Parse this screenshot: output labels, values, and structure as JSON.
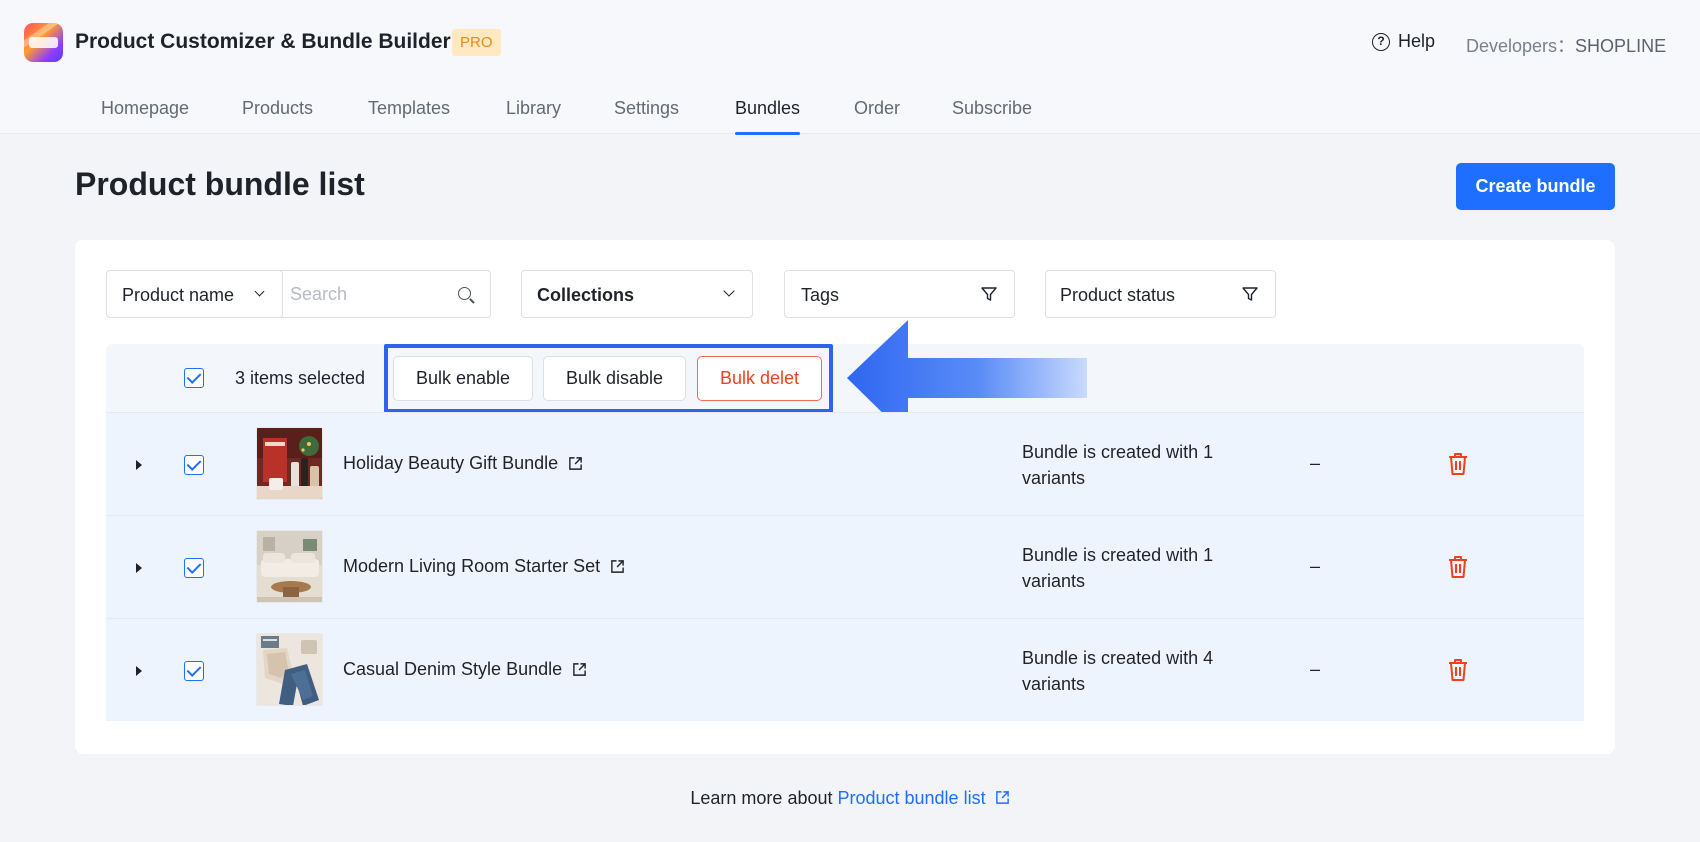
{
  "app": {
    "title": "Product Customizer & Bundle Builder",
    "badge": "PRO",
    "help_label": "Help",
    "developers_label": "Developers：",
    "developers_value": "SHOPLINE"
  },
  "nav": {
    "tabs": [
      {
        "label": "Homepage"
      },
      {
        "label": "Products"
      },
      {
        "label": "Templates"
      },
      {
        "label": "Library"
      },
      {
        "label": "Settings"
      },
      {
        "label": "Bundles",
        "active": true
      },
      {
        "label": "Order"
      },
      {
        "label": "Subscribe"
      }
    ]
  },
  "page": {
    "title": "Product bundle list",
    "create_label": "Create bundle"
  },
  "filters": {
    "field_select": "Product name",
    "search_placeholder": "Search",
    "collections": "Collections",
    "tags": "Tags",
    "status": "Product status"
  },
  "bulk": {
    "selected_text": "3 items selected",
    "enable_label": "Bulk enable",
    "disable_label": "Bulk disable",
    "delete_label": "Bulk delet"
  },
  "rows": [
    {
      "name": "Holiday Beauty Gift Bundle",
      "variants": "Bundle is created with 1 variants",
      "status": "–"
    },
    {
      "name": "Modern Living Room Starter Set",
      "variants": "Bundle is created with 1 variants",
      "status": "–"
    },
    {
      "name": "Casual Denim Style Bundle",
      "variants": "Bundle is created with 4 variants",
      "status": "–"
    }
  ],
  "footer": {
    "prefix": "Learn more about ",
    "link_label": "Product bundle list"
  },
  "colors": {
    "accent": "#1e6eff",
    "danger": "#f0411e",
    "highlight": "#2e63ee"
  },
  "icons": [
    "help-icon",
    "chevron-down-icon",
    "search-icon",
    "filter-icon",
    "external-link-icon",
    "trash-icon",
    "caret-right-icon",
    "checkbox-checked-icon",
    "arrow-left-icon"
  ]
}
